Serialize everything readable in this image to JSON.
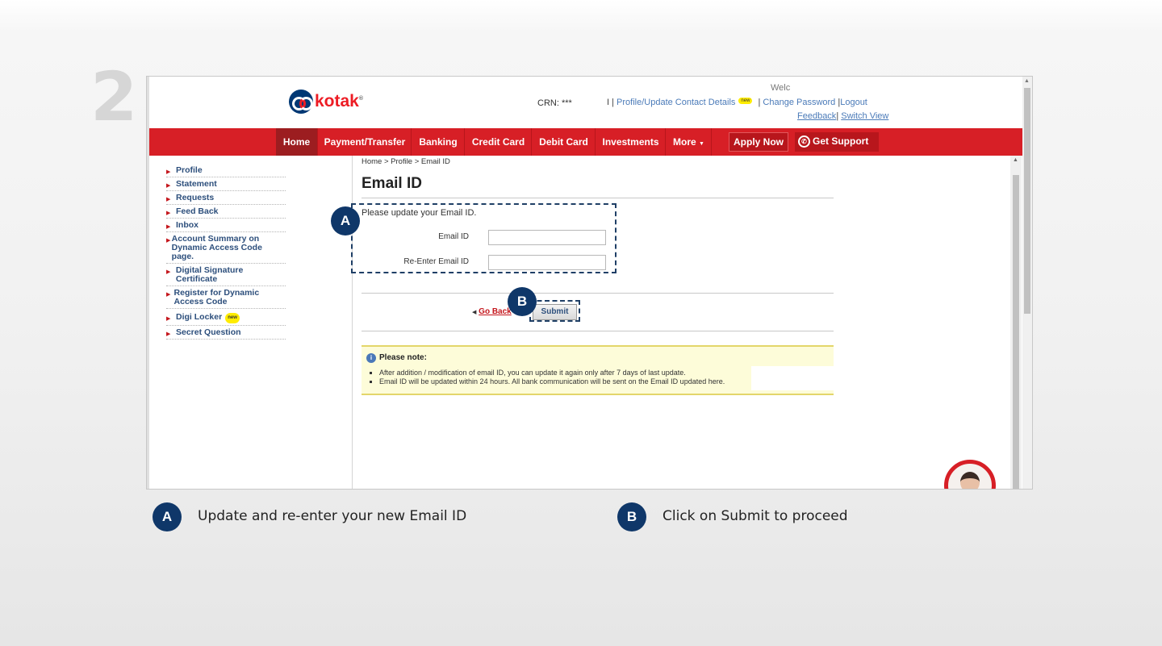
{
  "step_number": "2",
  "header": {
    "logo_text": "kotak",
    "welcome": "Welc",
    "crn": "CRN: ***",
    "crn_sep": "I  |",
    "profile_link": "Profile/Update Contact Details",
    "new_badge": "new",
    "change_password": "Change Password",
    "logout": "Logout",
    "feedback": "Feedback",
    "switch_view": "Switch View"
  },
  "nav": {
    "home": "Home",
    "payment": "Payment/Transfer",
    "banking": "Banking",
    "credit_card": "Credit Card",
    "debit_card": "Debit Card",
    "investments": "Investments",
    "more": "More",
    "more_arrow": "▼",
    "apply_now": "Apply Now",
    "get_support": "Get Support"
  },
  "sidebar": {
    "items": [
      {
        "label": "Profile"
      },
      {
        "label": "Statement"
      },
      {
        "label": "Requests"
      },
      {
        "label": "Feed Back"
      },
      {
        "label": "Inbox"
      },
      {
        "label": "Account Summary on Dynamic Access Code page."
      },
      {
        "label": "Digital Signature Certificate"
      },
      {
        "label": "Register for Dynamic Access Code"
      },
      {
        "label": "Digi Locker"
      },
      {
        "label": "Secret Question"
      }
    ],
    "digi_badge": "new"
  },
  "content": {
    "breadcrumb": "Home > Profile > Email ID",
    "title": "Email ID",
    "intro": "Please update your Email ID.",
    "email_label": "Email ID",
    "reenter_label": "Re-Enter Email ID",
    "email_value": "",
    "reenter_value": "",
    "go_back": "Go Back",
    "submit": "Submit",
    "note_title": "Please note:",
    "notes": [
      "After addition / modification of email ID, you can update it again only after 7 days of last update.",
      "Email ID will be updated within 24 hours. All bank communication will be sent on the Email ID updated here."
    ]
  },
  "markers": {
    "a": "A",
    "b": "B"
  },
  "captions": {
    "a_text": "Update and re-enter your new Email ID",
    "b_text": "Click on Submit to proceed"
  },
  "colors": {
    "brand_red": "#d71f26",
    "marker_blue": "#0f3769",
    "link_blue": "#4a7ab8"
  }
}
